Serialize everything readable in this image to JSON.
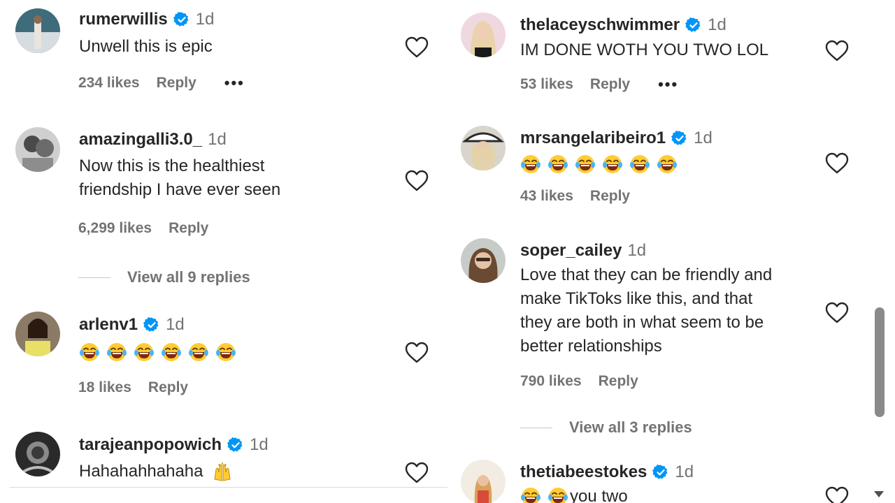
{
  "left_comments": [
    {
      "username": "rumerwillis",
      "verified": true,
      "time": "1d",
      "text": "Unwell this is epic",
      "likes": "234 likes",
      "reply": "Reply",
      "more": "•••"
    },
    {
      "username": "amazingalli3.0_",
      "verified": false,
      "time": "1d",
      "text_lines": [
        "Now this is the healthiest",
        "friendship I have ever seen"
      ],
      "likes": "6,299 likes",
      "reply": "Reply",
      "view_replies": "View all 9 replies"
    },
    {
      "username": "arlenv1",
      "verified": true,
      "time": "1d",
      "emoji_count": 6,
      "likes": "18 likes",
      "reply": "Reply"
    },
    {
      "username": "tarajeanpopowich",
      "verified": true,
      "time": "1d",
      "text": "Hahahahhahaha"
    }
  ],
  "right_comments": [
    {
      "username": "thelaceyschwimmer",
      "verified": true,
      "time": "1d",
      "text": "IM DONE WOTH YOU TWO LOL",
      "likes": "53 likes",
      "reply": "Reply",
      "more": "•••"
    },
    {
      "username": "mrsangelaribeiro1",
      "verified": true,
      "time": "1d",
      "emoji_count": 6,
      "likes": "43 likes",
      "reply": "Reply"
    },
    {
      "username": "soper_cailey",
      "verified": false,
      "time": "1d",
      "text_lines": [
        "Love that they can be friendly and",
        "make TikToks like this, and that",
        "they are both in what seem to be",
        "better relationships"
      ],
      "likes": "790 likes",
      "reply": "Reply",
      "view_replies": "View all 3 replies"
    },
    {
      "username": "thetiabeestokes",
      "verified": true,
      "time": "1d",
      "text": "you two",
      "emoji_count": 2
    }
  ],
  "colors": {
    "verified": "#0095f6",
    "secondary": "#737373",
    "primary": "#262626"
  },
  "icons": {
    "like": "heart-outline-icon",
    "verified": "verified-badge-icon",
    "emoji": "face-with-tears-of-joy-icon",
    "raised_hands": "raising-hands-icon"
  }
}
